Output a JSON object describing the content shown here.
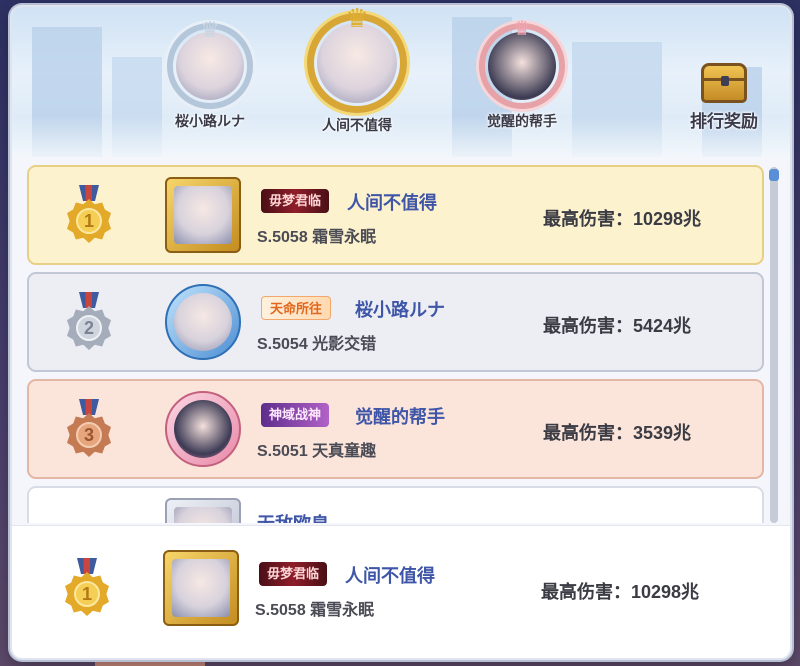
{
  "podium": [
    {
      "rank": 2,
      "name": "桜小路ルナ"
    },
    {
      "rank": 1,
      "name": "人间不值得"
    },
    {
      "rank": 3,
      "name": "觉醒的帮手"
    }
  ],
  "reward_button": {
    "label": "排行奖励"
  },
  "ranking": [
    {
      "rank": "1",
      "title": "毋梦君临",
      "name": "人间不值得",
      "server": "S.5058 霜雪永眠",
      "damage_label": "最高伤害：",
      "damage": "10298兆"
    },
    {
      "rank": "2",
      "title": "天命所往",
      "name": "桜小路ルナ",
      "server": "S.5054 光影交错",
      "damage_label": "最高伤害：",
      "damage": "5424兆"
    },
    {
      "rank": "3",
      "title": "神域战神",
      "name": "觉醒的帮手",
      "server": "S.5051 天真童趣",
      "damage_label": "最高伤害：",
      "damage": "3539兆"
    },
    {
      "rank": "",
      "title": "",
      "name": "无敌欧皇",
      "server": "",
      "damage_label": "",
      "damage": ""
    }
  ],
  "self_entry": {
    "rank": "1",
    "title": "毋梦君临",
    "name": "人间不值得",
    "server": "S.5058 霜雪永眠",
    "damage_label": "最高伤害：",
    "damage": "10298兆"
  },
  "colors": {
    "gold_row": "#fdf2ce",
    "silver_row": "#eceef4",
    "bronze_row": "#fbe4da",
    "name_blue": "#3e55a8"
  }
}
